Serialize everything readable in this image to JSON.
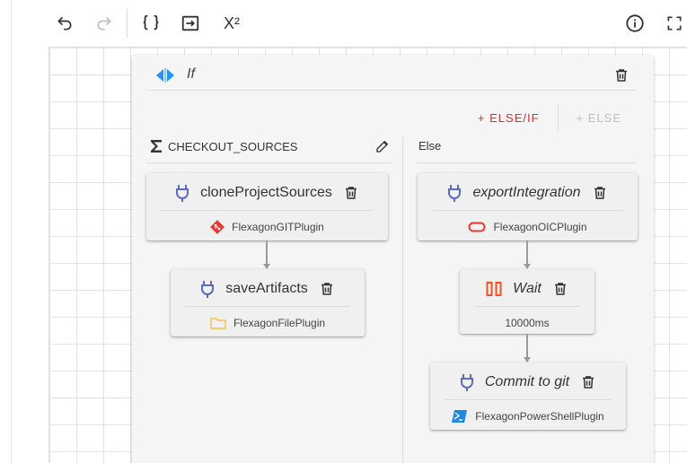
{
  "toolbar": {
    "undo_icon": "undo-icon",
    "redo_icon": "redo-icon",
    "json_icon": "code-braces-icon",
    "import_icon": "import-icon",
    "superscript_label": "X²",
    "info_icon": "info-icon",
    "fullscreen_icon": "fullscreen-icon"
  },
  "if_block": {
    "title": "If",
    "add_else_if_label": "+ ELSE/IF",
    "add_else_label": "+ ELSE",
    "branches": [
      {
        "heading": "CHECKOUT_SOURCES",
        "steps": [
          {
            "name": "cloneProjectSources",
            "plugin": "FlexagonGITPlugin",
            "italic": false
          },
          {
            "name": "saveArtifacts",
            "plugin": "FlexagonFilePlugin",
            "italic": false
          }
        ]
      },
      {
        "heading": "Else",
        "steps": [
          {
            "name": "exportIntegration",
            "plugin": "FlexagonOICPlugin",
            "italic": true
          },
          {
            "name": "Wait",
            "plugin": "10000ms",
            "italic": true
          },
          {
            "name": "Commit to git",
            "plugin": "FlexagonPowerShellPlugin",
            "italic": true
          }
        ]
      }
    ]
  },
  "colors": {
    "accent_blue": "#2196f3",
    "plug_blue": "#5c6bc0",
    "danger_red": "#d32f2f",
    "git_red": "#e53935",
    "folder_yellow": "#f6c343",
    "wait_orange": "#f4511e",
    "powershell_blue": "#1e88e5"
  }
}
